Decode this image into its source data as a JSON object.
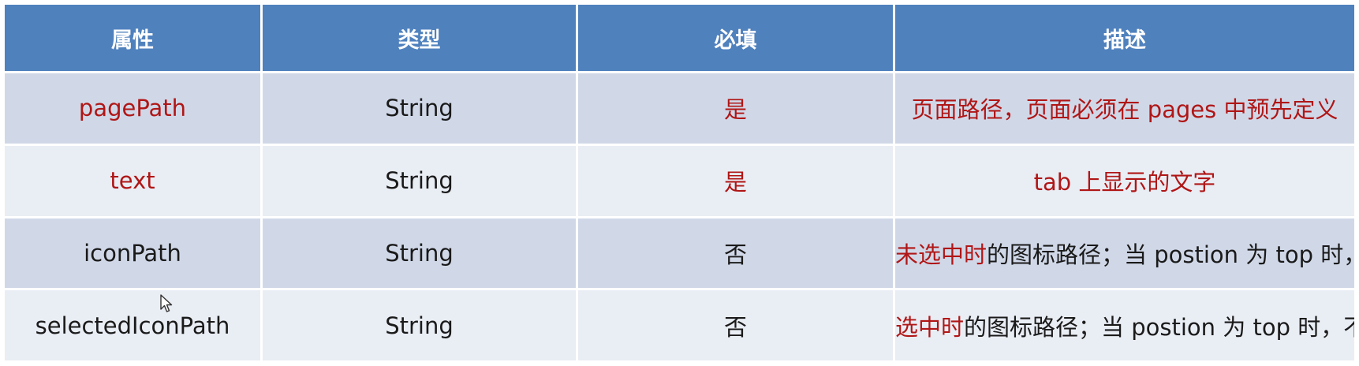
{
  "header": {
    "col1": "属性",
    "col2": "类型",
    "col3": "必填",
    "col4": "描述"
  },
  "rows": [
    {
      "name": "pagePath",
      "type": "String",
      "required": "是",
      "desc_prefix": "",
      "desc_rest": "页面路径，页面必须在 pages 中预先定义"
    },
    {
      "name": "text",
      "type": "String",
      "required": "是",
      "desc_prefix": "",
      "desc_rest": "tab 上显示的文字"
    },
    {
      "name": "iconPath",
      "type": "String",
      "required": "否",
      "desc_prefix": "未选中时",
      "desc_rest": "的图标路径；当 postion 为 top 时，不显示 icon"
    },
    {
      "name": "selectedIconPath",
      "type": "String",
      "required": "否",
      "desc_prefix": "选中时",
      "desc_rest": "的图标路径；当 postion 为 top 时，不显示 icon"
    }
  ],
  "colors": {
    "header_bg": "#4f81bd",
    "row_dark": "#d0d8e8",
    "row_light": "#e9edf4",
    "highlight": "#b01616"
  }
}
